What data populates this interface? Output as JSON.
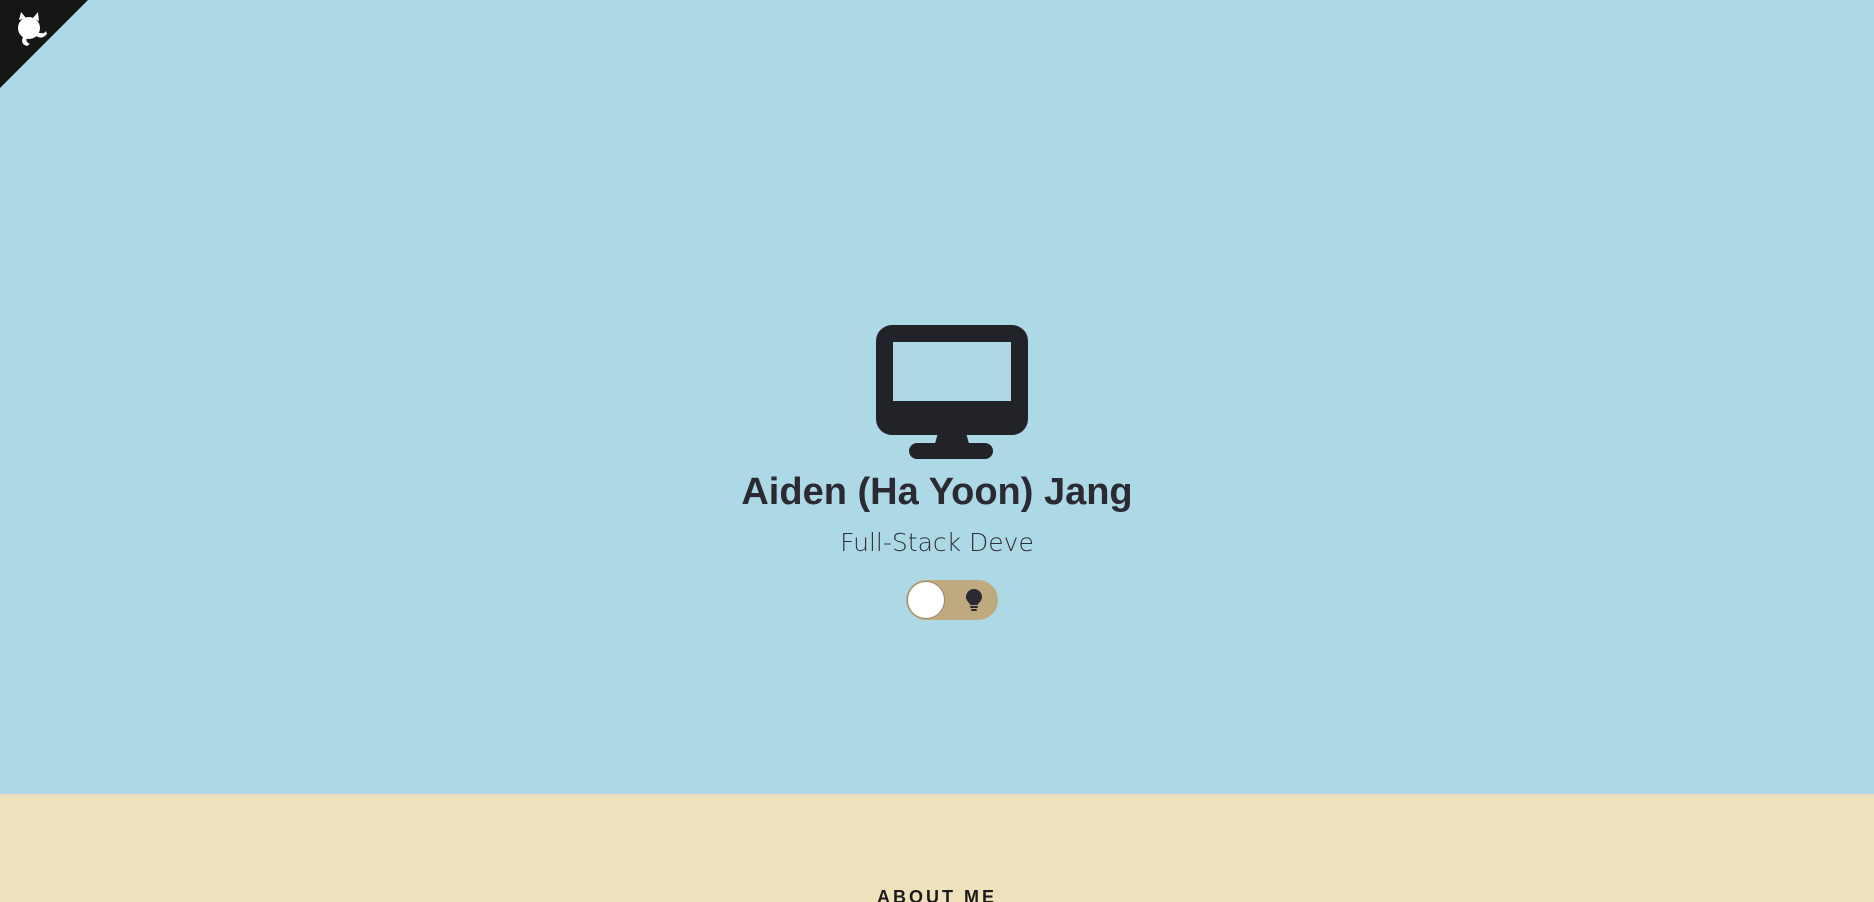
{
  "github_corner": {
    "icon": "github-octocat-icon",
    "background_color": "#151513",
    "icon_color": "#ffffff"
  },
  "hero": {
    "background_color": "#add8e6",
    "icon": "desktop-monitor-icon",
    "name": "Aiden (Ha Yoon) Jang",
    "subtitle": "Full-Stack Deve"
  },
  "theme_toggle": {
    "icon": "lightbulb-icon",
    "state": "off",
    "track_color": "#bfa97e"
  },
  "about": {
    "background_color": "#f0e1bd",
    "heading": "ABOUT ME"
  }
}
